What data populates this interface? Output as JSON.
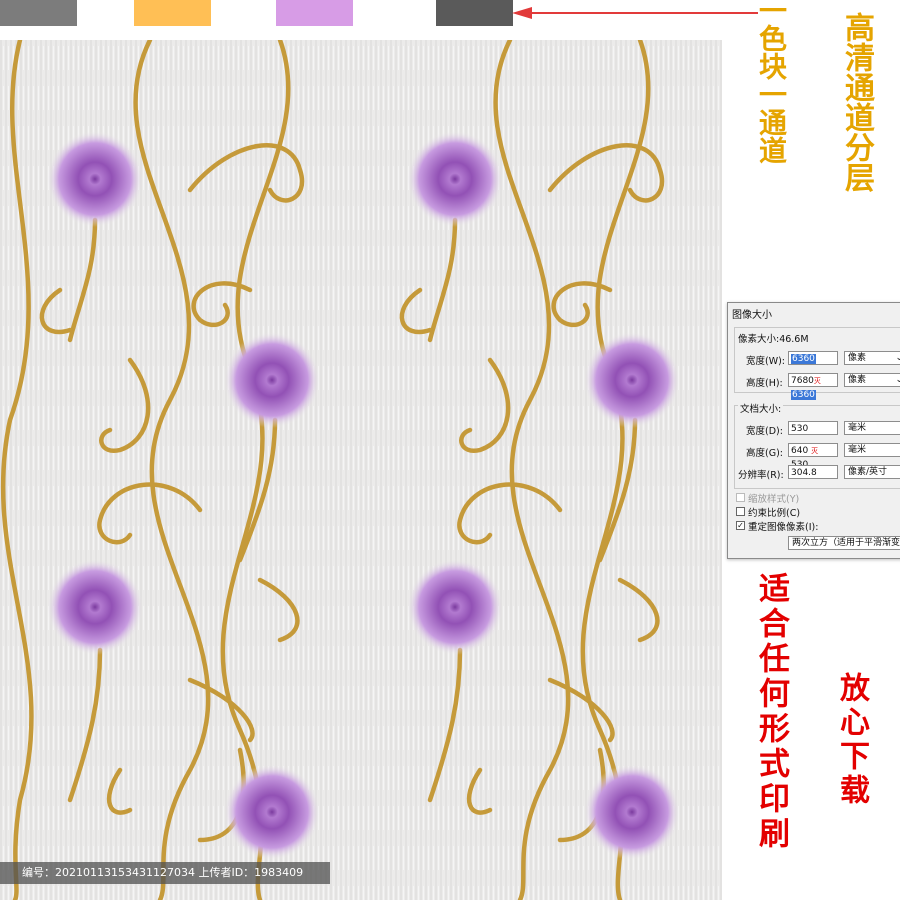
{
  "swatches": [
    "#7c7c7c",
    "#ffbf55",
    "#d79ce6",
    "#5a5a5a"
  ],
  "pattern": {
    "flower_color": "#8e4db1",
    "vine_color": "#c59a3a",
    "background": "#ecebea"
  },
  "notes": {
    "left_vertical": "一色块一通道",
    "right_vertical": "高清通道分层",
    "bottom_left_vertical": "适合任何形式印刷",
    "bottom_right_vertical": "放心下载"
  },
  "dialog": {
    "title": "图像大小",
    "pixel_group": "像素大小:46.6M",
    "width_label": "宽度(W):",
    "width_value": "6360",
    "width_unit": "像素",
    "height_label": "高度(H):",
    "height_value_old": "7680",
    "height_value_sel": "6360",
    "height_unit": "像素",
    "doc_group": "文档大小:",
    "doc_width_label": "宽度(D):",
    "doc_width_value": "530",
    "doc_width_unit": "毫米",
    "doc_height_label": "高度(G):",
    "doc_height_value": "640",
    "doc_height_value2": "530",
    "doc_height_unit": "毫米",
    "res_label": "分辨率(R):",
    "res_value": "304.8",
    "res_unit": "像素/英寸",
    "scale_styles": "缩放样式(Y)",
    "constrain": "约束比例(C)",
    "resample": "重定图像像素(I):",
    "resample_method": "两次立方（适用于平滑渐变"
  },
  "footer": "编号：20210113153431127034 上传者ID：1983409"
}
